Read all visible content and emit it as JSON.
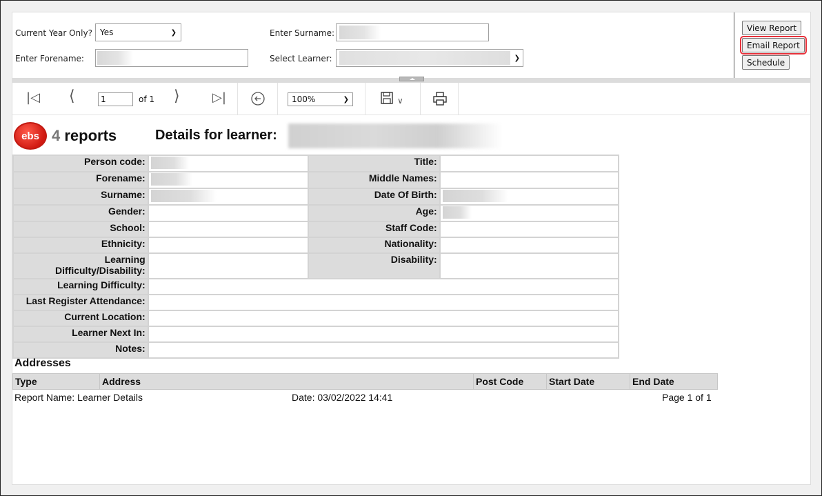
{
  "parameters": {
    "current_year_label": "Current Year Only?",
    "current_year_value": "Yes",
    "forename_label": "Enter Forename:",
    "forename_value": "",
    "surname_label": "Enter Surname:",
    "surname_value": "",
    "learner_label": "Select Learner:",
    "learner_value": ""
  },
  "actions": {
    "view_report": "View Report",
    "email_report": "Email Report",
    "schedule": "Schedule",
    "highlight_color": "#e8313b"
  },
  "toolbar": {
    "first_page_icon": "first-page-icon",
    "prev_page_icon": "previous-page-icon",
    "current_page": "1",
    "of_pages": "of 1",
    "next_page_icon": "next-page-icon",
    "last_page_icon": "last-page-icon",
    "back_icon": "back-to-parent-icon",
    "zoom": "100%",
    "save_icon": "save-icon",
    "print_icon": "print-icon"
  },
  "report": {
    "logo_badge": "ebs",
    "logo_four": "4",
    "logo_reports": "reports",
    "title": "Details for learner:",
    "details_left": [
      {
        "label": "Person code:"
      },
      {
        "label": "Forename:"
      },
      {
        "label": "Surname:"
      },
      {
        "label": "Gender:"
      },
      {
        "label": "School:"
      },
      {
        "label": "Ethnicity:"
      },
      {
        "label": "Learning Difficulty/Disability:"
      }
    ],
    "details_right": [
      {
        "label": "Title:"
      },
      {
        "label": "Middle Names:"
      },
      {
        "label": "Date Of Birth:"
      },
      {
        "label": "Age:"
      },
      {
        "label": "Staff Code:"
      },
      {
        "label": "Nationality:"
      },
      {
        "label": "Disability:"
      }
    ],
    "details_full": [
      {
        "label": "Learning Difficulty:"
      },
      {
        "label": "Last Register Attendance:"
      },
      {
        "label": "Current Location:"
      },
      {
        "label": "Learner Next In:"
      },
      {
        "label": "Notes:"
      }
    ],
    "addresses_heading": "Addresses",
    "address_columns": [
      "Type",
      "Address",
      "Post Code",
      "Start Date",
      "End Date"
    ],
    "footer": {
      "report_name": "Report Name: Learner Details",
      "date": "Date: 03/02/2022 14:41",
      "page": "Page 1 of 1"
    }
  }
}
